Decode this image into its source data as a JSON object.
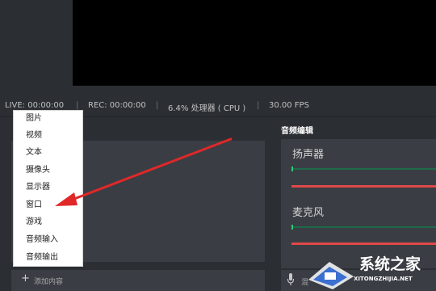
{
  "status_bar": {
    "live": "LIVE: 00:00:00",
    "rec": "REC: 00:00:00",
    "cpu": "6.4% 处理器 ( CPU )",
    "fps": "30.00 FPS",
    "separator": "|"
  },
  "context_menu": {
    "items": [
      "图片",
      "视频",
      "文本",
      "摄像头",
      "显示器",
      "窗口",
      "游戏",
      "音频输入",
      "音频输出"
    ],
    "highlighted": "窗口"
  },
  "sources": {
    "add_label": "添加内容",
    "add_icon": "plus-icon"
  },
  "mixer": {
    "title": "音频编辑",
    "tracks": [
      "扬声器",
      "麦克风"
    ],
    "footer_partial": "混",
    "footer_icon": "microphone-icon"
  },
  "watermark": {
    "text": "系统之家",
    "sub": "XITONGZHIJIA.NET"
  },
  "colors": {
    "background": "#2b2e33",
    "panel": "#3a3d44",
    "preview": "#000000",
    "arrow": "#e02828",
    "meter_red": "#e04848",
    "meter_green": "#2ec77a"
  }
}
